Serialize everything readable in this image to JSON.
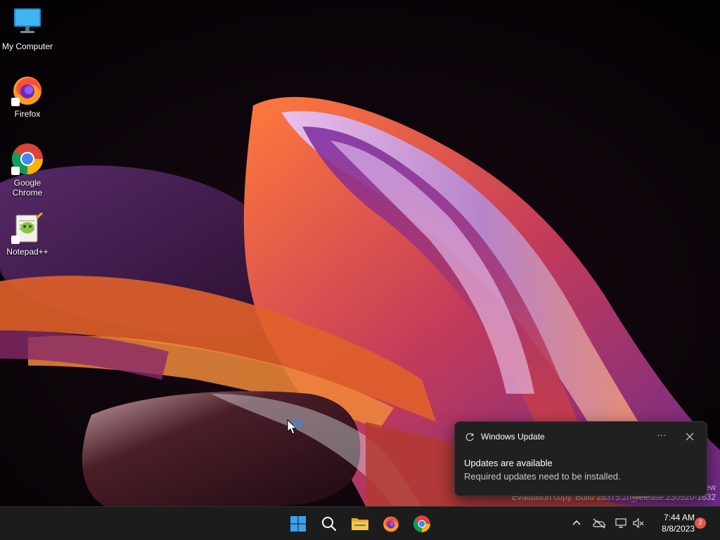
{
  "desktop": {
    "icons": [
      {
        "label": "My Computer",
        "icon": "monitor-icon"
      },
      {
        "label": "Firefox",
        "icon": "firefox-icon"
      },
      {
        "label": "Google Chrome",
        "icon": "chrome-icon"
      },
      {
        "label": "Notepad++",
        "icon": "notepad-plus-plus-icon"
      }
    ]
  },
  "watermark": {
    "line1": "ew",
    "line2": "Evaluation copy. Build 25375.zn_release.230520-1632"
  },
  "toast": {
    "app_name": "Windows Update",
    "more_label": "···",
    "title": "Updates are available",
    "body": "Required updates need to be installed."
  },
  "taskbar": {
    "pinned": [
      {
        "name": "start-button",
        "icon": "windows-logo-icon"
      },
      {
        "name": "search-button",
        "icon": "search-icon"
      },
      {
        "name": "file-explorer-button",
        "icon": "folder-icon"
      },
      {
        "name": "firefox-taskbar-button",
        "icon": "firefox-icon"
      },
      {
        "name": "chrome-taskbar-button",
        "icon": "chrome-icon"
      }
    ],
    "tray": {
      "icons": [
        "chevron-up-icon",
        "onedrive-offline-icon",
        "network-icon",
        "volume-muted-icon"
      ],
      "time": "7:44 AM",
      "date": "8/8/2023",
      "notification_count": "2"
    }
  },
  "colors": {
    "taskbar_bg": "#1c1c1c",
    "toast_bg": "#202020",
    "badge": "#e2574c",
    "accent": "#0078d4"
  }
}
